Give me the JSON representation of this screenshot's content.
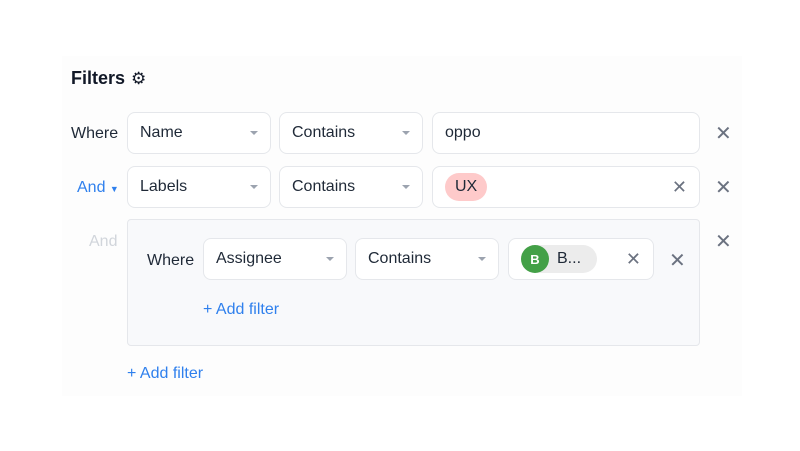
{
  "title": "Filters",
  "rows": [
    {
      "conj": "Where",
      "field": "Name",
      "op": "Contains",
      "value": "oppo"
    },
    {
      "conj": "And",
      "field": "Labels",
      "op": "Contains",
      "chip": "UX"
    }
  ],
  "group": {
    "conj": "And",
    "row": {
      "conj": "Where",
      "field": "Assignee",
      "op": "Contains",
      "avatar_initial": "B",
      "person": "B..."
    },
    "add": "+ Add filter"
  },
  "add": "+ Add filter",
  "colors": {
    "accent": "#2f80ed",
    "chip": "#fecaca",
    "avatar": "#43a047"
  }
}
